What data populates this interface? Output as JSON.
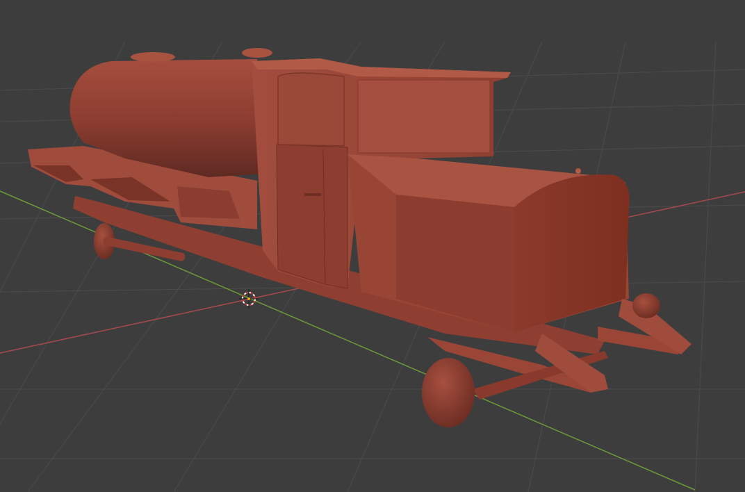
{
  "viewport": {
    "background_color": "#3d3d3d",
    "grid_color": "#4d4d4d",
    "x_axis_color": "#a84a50",
    "y_axis_color": "#6d9a3a",
    "model_color": "#9b4537"
  },
  "model": {
    "name": "",
    "shading": "solid",
    "parts": [
      "tank",
      "cab",
      "hood",
      "front-wheel",
      "rear-wheel",
      "chassis",
      "leaf-spring",
      "flatbed"
    ]
  },
  "cursor": {
    "icon": "3d-cursor-icon"
  }
}
